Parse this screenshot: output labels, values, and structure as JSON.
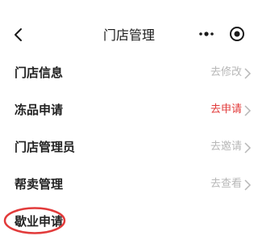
{
  "nav": {
    "title": "门店管理"
  },
  "items": [
    {
      "label": "门店信息",
      "action": "去修改"
    },
    {
      "label": "冻品申请",
      "action": "去申请",
      "action_color": "#e23b3b"
    },
    {
      "label": "门店管理员",
      "action": "去邀请"
    },
    {
      "label": "帮卖管理",
      "action": "去查看"
    },
    {
      "label": "歇业申请"
    }
  ],
  "colors": {
    "action_default": "#b7b7b7",
    "action_highlight": "#e23b3b",
    "annotation_circle": "#e23b3b"
  },
  "icons": [
    "back-arrow-icon",
    "more-dots-icon",
    "target-icon",
    "chevron-right-icon"
  ]
}
